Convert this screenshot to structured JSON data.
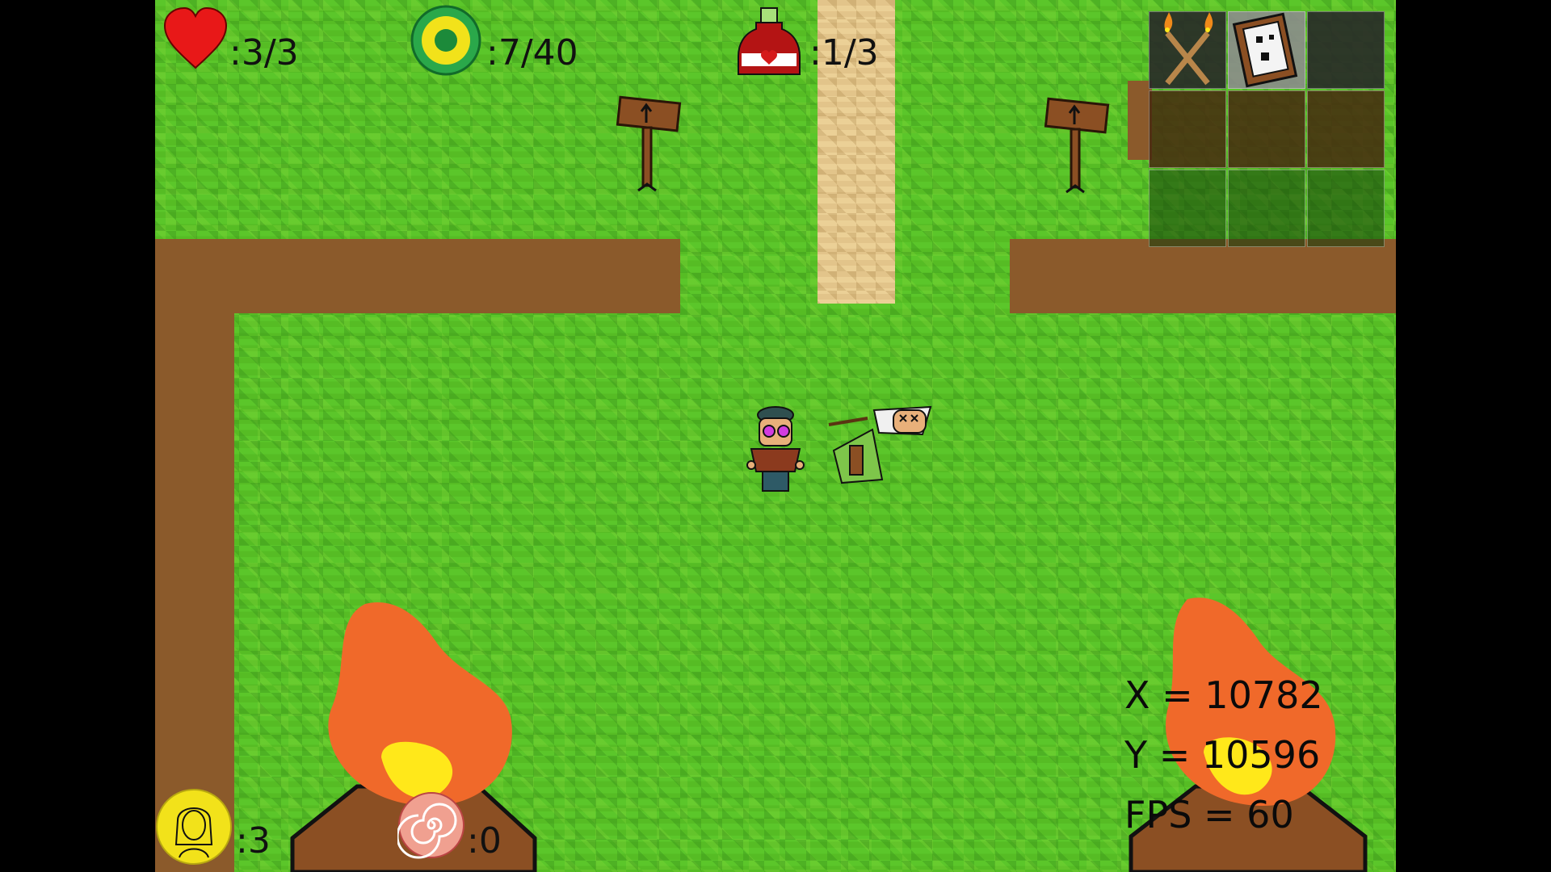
{
  "hud": {
    "health_text": ":3/3",
    "coins_text": ":7/40",
    "potions_text": ":1/3",
    "companions_text": ":3",
    "spiral_text": ":0"
  },
  "debug": {
    "x_text": "X = 10782",
    "y_text": "Y = 10596",
    "fps_text": "FPS = 60"
  },
  "inventory": {
    "slots": [
      {
        "item": "crossed-torches-icon"
      },
      {
        "item": "note-card-icon"
      },
      {
        "item": ""
      },
      {
        "item": ""
      },
      {
        "item": ""
      },
      {
        "item": ""
      },
      {
        "item": ""
      },
      {
        "item": ""
      },
      {
        "item": ""
      }
    ]
  },
  "colors": {
    "grass": "#5bc62a",
    "wall": "#8b5a2b",
    "fire_outer": "#f0692a",
    "fire_inner": "#ffe81a",
    "path": "#e2c48a"
  }
}
